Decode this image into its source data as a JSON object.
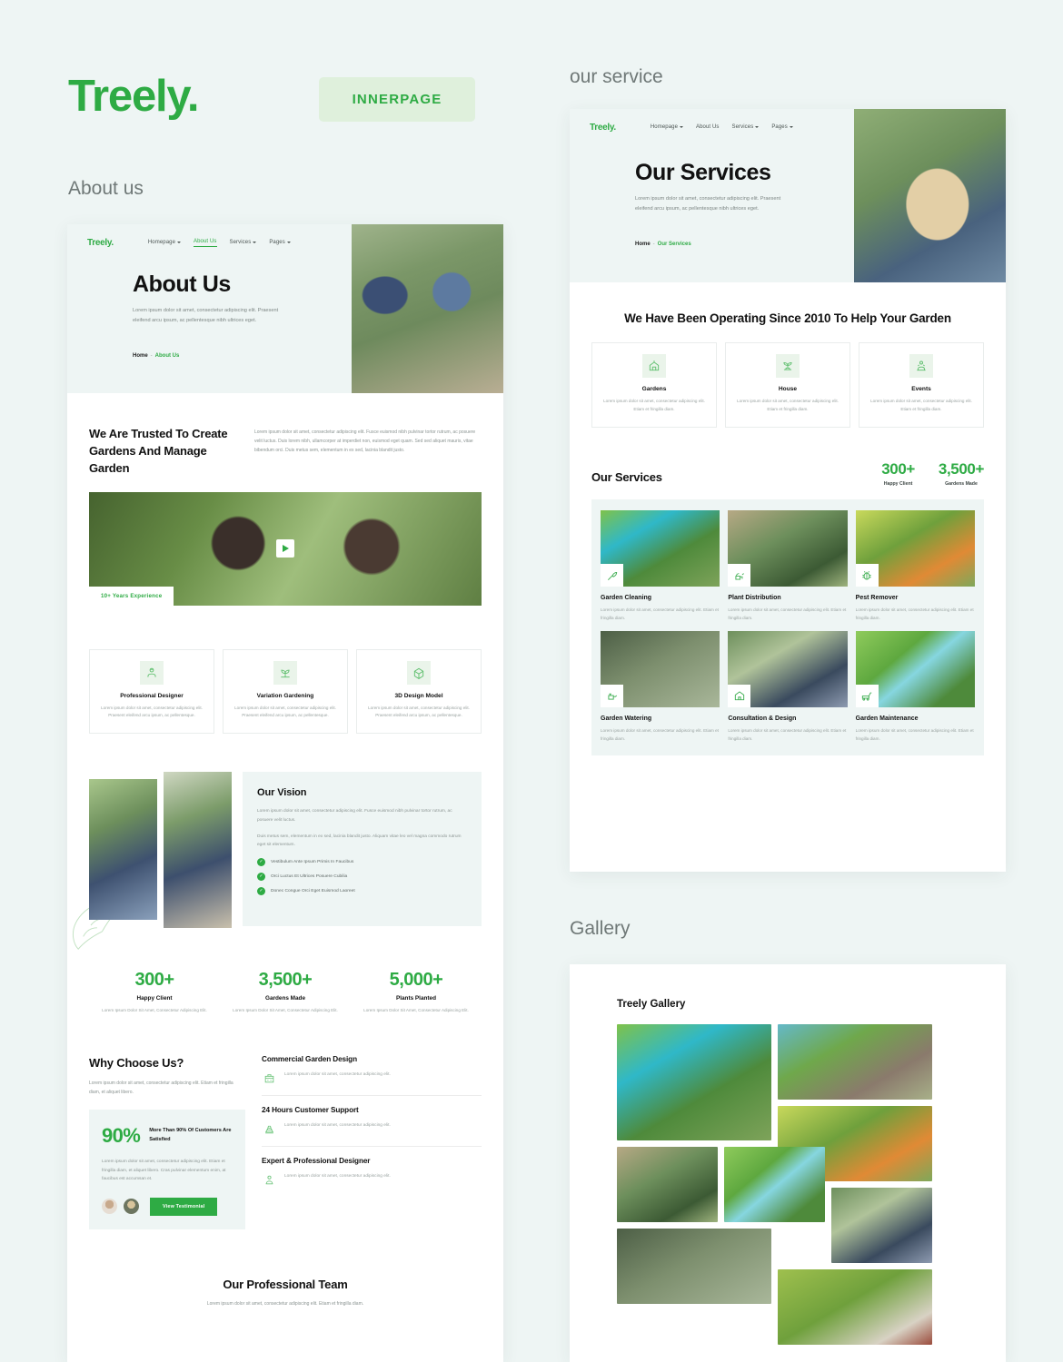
{
  "brand": {
    "name": "Treely",
    "dot": "."
  },
  "badge": {
    "label": "INNERPAGE"
  },
  "captions": {
    "about": "About us",
    "service": "our service",
    "gallery": "Gallery"
  },
  "nav": {
    "logo": "Treely.",
    "items_about": [
      {
        "label": "Homepage",
        "caret": true,
        "active": false
      },
      {
        "label": "About Us",
        "caret": false,
        "active": true
      },
      {
        "label": "Services",
        "caret": true,
        "active": false
      },
      {
        "label": "Pages",
        "caret": true,
        "active": false
      }
    ],
    "items_service": [
      {
        "label": "Homepage",
        "caret": true,
        "active": false
      },
      {
        "label": "About Us",
        "caret": false,
        "active": false
      },
      {
        "label": "Services",
        "caret": true,
        "active": false
      },
      {
        "label": "Pages",
        "caret": true,
        "active": false
      }
    ]
  },
  "about_page": {
    "hero": {
      "title": "About Us",
      "subtitle": "Lorem ipsum dolor sit amet, consectetur adipiscing elit. Praesent eleifend arcu ipsum, ac pellentesque nibh ultrices eget.",
      "crumb_home": "Home",
      "crumb_sep": "-",
      "crumb_current": "About Us"
    },
    "trusted": {
      "heading": "We Are Trusted To Create Gardens And Manage Garden",
      "body": "Lorem ipsum dolor sit amet, consectetur adipiscing elit. Fusce euismod nibh pulvinar tortor rutrum, ac posuere velit luctus. Duis lorem nibh, ullamcorper at imperdiet non, euismod eget quam. Sed sed aliquet mauris, vitae bibendum orci. Duis metus sem, elementum in ex sed, lacinia blandit justo.",
      "experience_badge": "10+ Years Experience"
    },
    "features": [
      {
        "icon": "designer-icon",
        "title": "Professional Designer",
        "desc": "Lorem ipsum dolor sit amet, consectetur adipiscing elit. Praesent eleifend arcu ipsum, ac pellentesque."
      },
      {
        "icon": "sprout-icon",
        "title": "Variation Gardening",
        "desc": "Lorem ipsum dolor sit amet, consectetur adipiscing elit. Praesent eleifend arcu ipsum, ac pellentesque."
      },
      {
        "icon": "cube-icon",
        "title": "3D Design Model",
        "desc": "Lorem ipsum dolor sit amet, consectetur adipiscing elit. Praesent eleifend arcu ipsum, ac pellentesque."
      }
    ],
    "vision": {
      "title": "Our Vision",
      "p1": "Lorem ipsum dolor sit amet, consectetur adipiscing elit. Fusce euismod nibh pulvinar tortor rutrum, ac posuere velit luctus.",
      "p2": "Duis metus sem, elementum in ex sed, lacinia blandit justo. Aliquam vitae leo vel magna commodo rutrum eget sit elementum.",
      "list": [
        "Vestibulum Ante Ipsum Primis In Faucibus",
        "Orci Luctus Et Ultrices Posuere Cubilia",
        "Donec Congue Orci Eget Euismod Laoreet"
      ]
    },
    "stats": [
      {
        "number": "300+",
        "label": "Happy Client",
        "desc": "Lorem Ipsum Dolor Sit Amet, Consectetur Adipiscing Elit."
      },
      {
        "number": "3,500+",
        "label": "Gardens Made",
        "desc": "Lorem Ipsum Dolor Sit Amet, Consectetur Adipiscing Elit."
      },
      {
        "number": "5,000+",
        "label": "Plants Planted",
        "desc": "Lorem Ipsum Dolor Sit Amet, Consectetur Adipiscing Elit."
      }
    ],
    "why": {
      "heading": "Why Choose Us?",
      "lead": "Lorem ipsum dolor sit amet, consectetur adipiscing elit. Etiam et fringilla diam, et aliquet libero.",
      "percent": "90%",
      "percent_text": "More Than 90% Of Customers Are Satisfied",
      "percent_desc": "Lorem ipsum dolor sit amet, consectetur adipiscing elit. Etiam et fringilla diam, et aliquet libero. Cras pulvinar elementum enim, at faucibus est accumsan et.",
      "button": "View Testimonial",
      "items": [
        {
          "icon": "garden-design-icon",
          "title": "Commercial Garden Design",
          "desc": "Lorem ipsum dolor sit amet, consectetur adipiscing elit."
        },
        {
          "icon": "support-icon",
          "title": "24 Hours Customer Support",
          "desc": "Lorem ipsum dolor sit amet, consectetur adipiscing elit."
        },
        {
          "icon": "expert-icon",
          "title": "Expert & Professional Designer",
          "desc": "Lorem ipsum dolor sit amet, consectetur adipiscing elit."
        }
      ]
    },
    "team": {
      "heading": "Our Professional Team",
      "desc": "Lorem ipsum dolor sit amet, consectetur adipiscing elit. Etiam et fringilla diam."
    }
  },
  "service_page": {
    "hero": {
      "title": "Our Services",
      "subtitle": "Lorem ipsum dolor sit amet, consectetur adipiscing elit. Praesent eleifend arcu ipsum, ac pellentesque nibh ultrices eget.",
      "crumb_home": "Home",
      "crumb_sep": "-",
      "crumb_current": "Our Services"
    },
    "operating": {
      "heading": "We Have Been Operating Since 2010 To Help Your Garden",
      "cards": [
        {
          "icon": "garden-icon",
          "title": "Gardens",
          "desc": "Lorem ipsum dolor sit amet, consectetur adipiscing elit. Etiam et fringilla diam."
        },
        {
          "icon": "house-icon",
          "title": "House",
          "desc": "Lorem ipsum dolor sit amet, consectetur adipiscing elit. Etiam et fringilla diam."
        },
        {
          "icon": "events-icon",
          "title": "Events",
          "desc": "Lorem ipsum dolor sit amet, consectetur adipiscing elit. Etiam et fringilla diam."
        }
      ]
    },
    "services": {
      "heading": "Our Services",
      "counts": [
        {
          "number": "300+",
          "label": "Happy Client"
        },
        {
          "number": "3,500+",
          "label": "Gardens Made"
        }
      ],
      "items": [
        {
          "icon": "axe-icon",
          "title": "Garden Cleaning",
          "desc": "Lorem ipsum dolor sit amet, consectetur adipiscing elit. Etiam et fringilla diam."
        },
        {
          "icon": "watering-icon",
          "title": "Plant Distribution",
          "desc": "Lorem ipsum dolor sit amet, consectetur adipiscing elit. Etiam et fringilla diam."
        },
        {
          "icon": "bug-icon",
          "title": "Pest Remover",
          "desc": "Lorem ipsum dolor sit amet, consectetur adipiscing elit. Etiam et fringilla diam."
        },
        {
          "icon": "sprinkler-icon",
          "title": "Garden Watering",
          "desc": "Lorem ipsum dolor sit amet, consectetur adipiscing elit. Etiam et fringilla diam."
        },
        {
          "icon": "house2-icon",
          "title": "Consultation & Design",
          "desc": "Lorem ipsum dolor sit amet, consectetur adipiscing elit. Etiam et fringilla diam."
        },
        {
          "icon": "mower-icon",
          "title": "Garden Maintenance",
          "desc": "Lorem ipsum dolor sit amet, consectetur adipiscing elit. Etiam et fringilla diam."
        }
      ]
    }
  },
  "gallery_page": {
    "title": "Treely Gallery",
    "images": [
      {
        "alt": "gardener-trimming-conifer"
      },
      {
        "alt": "gardener-pruning-shrubs"
      },
      {
        "alt": "hedge-trimming-worker"
      },
      {
        "alt": "planting-seedlings"
      },
      {
        "alt": "aerial-formal-garden"
      },
      {
        "alt": "couple-with-laptop-garden"
      },
      {
        "alt": "garden-hose-watering"
      },
      {
        "alt": "woman-in-hedge-garden"
      }
    ]
  },
  "colors": {
    "brand_green": "#2eab44",
    "page_bg": "#eef5f4",
    "card_bg": "#ffffff",
    "badge_bg": "#dff0dc",
    "muted_text": "#8b9492"
  }
}
